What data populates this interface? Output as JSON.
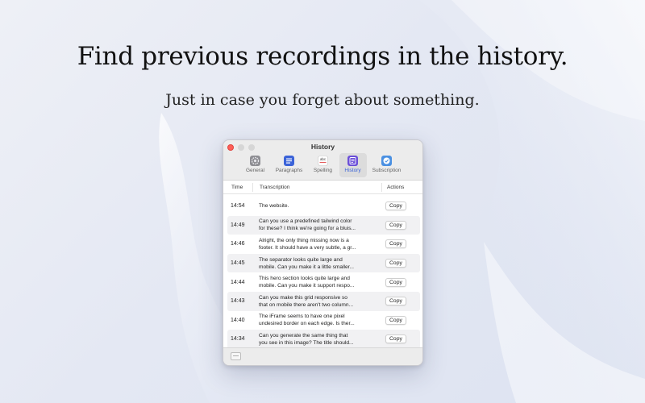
{
  "hero": {
    "title": "Find previous recordings in the history.",
    "subtitle": "Just in case you forget about something."
  },
  "window": {
    "title": "History",
    "toolbar": [
      {
        "label": "General",
        "icon": "gear-icon",
        "active": false
      },
      {
        "label": "Paragraphs",
        "icon": "paragraphs-icon",
        "active": false
      },
      {
        "label": "Spelling",
        "icon": "spelling-icon",
        "icon_text": "abc",
        "active": false
      },
      {
        "label": "History",
        "icon": "history-icon",
        "active": true
      },
      {
        "label": "Subscription",
        "icon": "checkmark-badge-icon",
        "active": false
      }
    ],
    "table": {
      "headers": {
        "time": "Time",
        "transcription": "Transcription",
        "actions": "Actions"
      },
      "rows": [
        {
          "time": "14:54",
          "line1": "The website.",
          "line2": "",
          "action": "Copy"
        },
        {
          "time": "14:49",
          "line1": "Can you use a predefined tailwind color",
          "line2": "for these? I think we're going for a bluis...",
          "action": "Copy"
        },
        {
          "time": "14:46",
          "line1": "Alright, the only thing missing now is a",
          "line2": "footer. It should have a very subtle, a gr...",
          "action": "Copy"
        },
        {
          "time": "14:45",
          "line1": "The separator looks quite large and",
          "line2": "mobile. Can you make it a little smaller...",
          "action": "Copy"
        },
        {
          "time": "14:44",
          "line1": "This hero section looks quite large and",
          "line2": "mobile. Can you make it support respo...",
          "action": "Copy"
        },
        {
          "time": "14:43",
          "line1": "Can you make this grid responsive so",
          "line2": "that on mobile there aren't two column...",
          "action": "Copy"
        },
        {
          "time": "14:40",
          "line1": "The iFrame seems to have one pixel",
          "line2": "undesired border on each edge. Is ther...",
          "action": "Copy"
        },
        {
          "time": "14:34",
          "line1": "Can you generate the same thing that",
          "line2": "you see in this image? The title should...",
          "action": "Copy"
        }
      ]
    },
    "footer": {
      "button": "—"
    }
  },
  "colors": {
    "accent": "#3b63d8",
    "close_dot": "#fe5f57",
    "background": "#e4e8f3"
  }
}
